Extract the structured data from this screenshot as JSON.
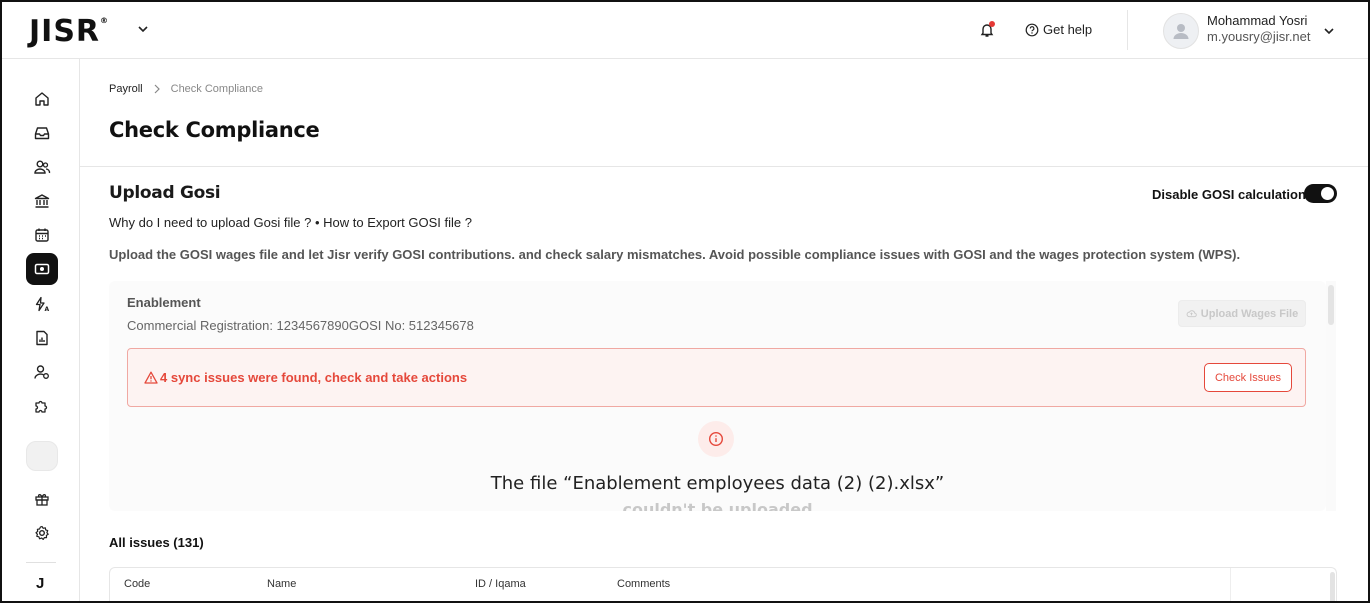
{
  "app": {
    "logo": "JISR",
    "logo_mark": "®"
  },
  "header": {
    "help_label": "Get help",
    "user_name": "Mohammad Yosri",
    "user_email": "m.yousry@jisr.net"
  },
  "sidebar": {
    "items": [
      "home-icon",
      "inbox-icon",
      "people-icon",
      "bank-icon",
      "calendar-icon",
      "payroll-icon",
      "automation-icon",
      "report-icon",
      "user-settings-icon",
      "puzzle-icon",
      "gift-icon",
      "gear-icon"
    ],
    "active": "payroll-icon",
    "footer_mark": "J"
  },
  "breadcrumb": {
    "parent": "Payroll",
    "current": "Check Compliance"
  },
  "page": {
    "title": "Check Compliance"
  },
  "upload": {
    "title": "Upload Gosi",
    "toggle_label": "Disable GOSI calculation",
    "toggle_on": true,
    "links": "Why do I need to upload Gosi file ? • How to Export GOSI file ?",
    "description": "Upload the GOSI wages file and let Jisr verify GOSI contributions. and check salary mismatches. Avoid possible compliance issues with GOSI and the wages protection system (WPS)."
  },
  "card": {
    "org_name": "Enablement",
    "org_meta": "Commercial Registration: 1234567890GOSI No: 512345678",
    "upload_button": "Upload Wages File",
    "alert_text": "4 sync issues were found, check and take actions",
    "check_button": "Check Issues",
    "error_line1": "The file “Enablement employees data (2) (2).xlsx”",
    "error_line2": "couldn't be uploaded"
  },
  "issues": {
    "title": "All issues (131)",
    "columns": [
      "Code",
      "Name",
      "ID / Iqama",
      "Comments"
    ]
  },
  "colors": {
    "alert": "#e5483b",
    "alert_bg": "#fdf3f2",
    "active_nav": "#111111"
  }
}
